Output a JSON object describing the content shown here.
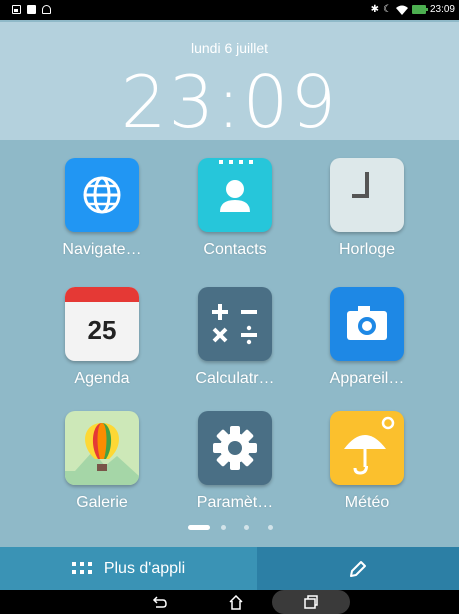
{
  "status_bar": {
    "time": "23:09",
    "left_icons": [
      "gallery-icon",
      "message-icon",
      "share-icon"
    ],
    "right_icons": [
      "bluetooth-icon",
      "moon-icon",
      "wifi-icon",
      "battery-charging-icon"
    ]
  },
  "clock_widget": {
    "date": "lundi 6 juillet",
    "time": "23:09"
  },
  "apps": [
    {
      "label": "Navigate…",
      "icon": "globe-icon"
    },
    {
      "label": "Contacts",
      "icon": "contact-person-icon"
    },
    {
      "label": "Horloge",
      "icon": "clock-icon"
    },
    {
      "label": "Agenda",
      "icon": "calendar-icon",
      "badge": "25"
    },
    {
      "label": "Calculatr…",
      "icon": "calculator-icon"
    },
    {
      "label": "Appareil…",
      "icon": "camera-icon"
    },
    {
      "label": "Galerie",
      "icon": "balloon-icon"
    },
    {
      "label": "Paramèt…",
      "icon": "gear-icon"
    },
    {
      "label": "Météo",
      "icon": "umbrella-sun-icon"
    }
  ],
  "page_indicator": {
    "pages": 4,
    "current": 1
  },
  "dock": {
    "more_apps_label": "Plus d'appli",
    "edit_icon": "pencil-icon"
  },
  "nav_bar": {
    "buttons": [
      "back-icon",
      "home-icon",
      "recent-apps-icon"
    ]
  },
  "colors": {
    "wallpaper": "#8fb9c8",
    "dock_left": "#3a93b5",
    "dock_right": "#2c7fa5"
  }
}
